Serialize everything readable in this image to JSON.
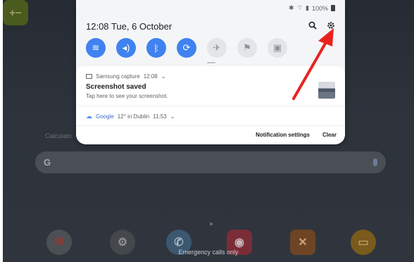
{
  "status_bar": {
    "bluetooth_icon": "bluetooth-icon",
    "wifi_icon": "wifi-icon",
    "signal_icon": "signal-icon",
    "battery": "100%"
  },
  "header": {
    "time": "12:08",
    "date": "Tue, 6 October"
  },
  "quick_settings": [
    {
      "icon": "wifi-icon",
      "state": "on"
    },
    {
      "icon": "sound-icon",
      "state": "on"
    },
    {
      "icon": "bluetooth-icon",
      "state": "on"
    },
    {
      "icon": "auto-rotate-icon",
      "state": "on"
    },
    {
      "icon": "airplane-mode-icon",
      "state": "off"
    },
    {
      "icon": "flashlight-icon",
      "state": "off"
    },
    {
      "icon": "power-saving-icon",
      "state": "off"
    }
  ],
  "notification_capture": {
    "app": "Samsung capture",
    "time": "12:08",
    "title": "Screenshot saved",
    "body": "Tap here to see your screenshot."
  },
  "notification_weather": {
    "app": "Google",
    "details": "12° in Dublin",
    "time": "11:53"
  },
  "footer": {
    "settings_label": "Notification settings",
    "clear_label": "Clear"
  },
  "home": {
    "calculator_label": "Calculato",
    "emergency_text": "Emergency calls only"
  },
  "colors": {
    "accent": "#3f82f0",
    "arrow": "#e8231f"
  }
}
